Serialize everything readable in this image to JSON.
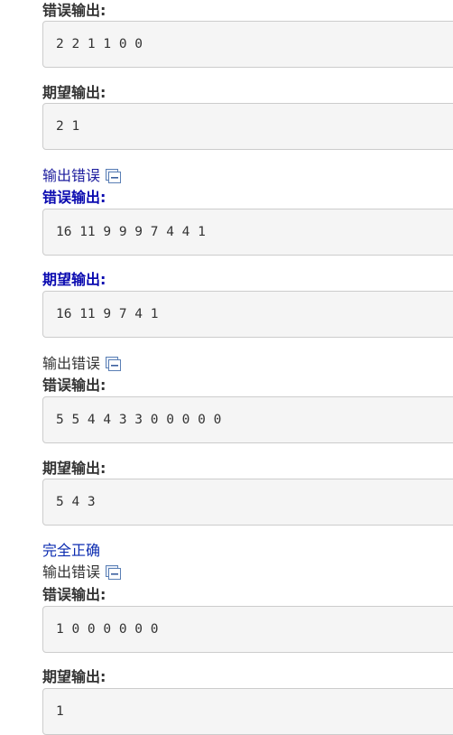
{
  "labels": {
    "wrong_output": "错误输出:",
    "expected_output": "期望输出:"
  },
  "status": {
    "output_error": "输出错误",
    "all_correct": "完全正确"
  },
  "icons": {
    "toggle": "collapse-icon"
  },
  "colors": {
    "link_blue": "#1d1d9e",
    "box_bg": "#f5f5f5",
    "box_border": "#cccccc"
  },
  "cases": {
    "c1": {
      "wrong": "2 2 1 1 0 0",
      "expected": "2 1"
    },
    "c2": {
      "wrong": "16 11 9 9 9 7 4 4 1",
      "expected": "16 11 9 7 4 1"
    },
    "c3": {
      "wrong": "5 5 4 4 3 3 0 0 0 0 0",
      "expected": "5 4 3"
    },
    "c4": {
      "wrong": "1 0 0 0 0 0 0",
      "expected": "1"
    }
  }
}
